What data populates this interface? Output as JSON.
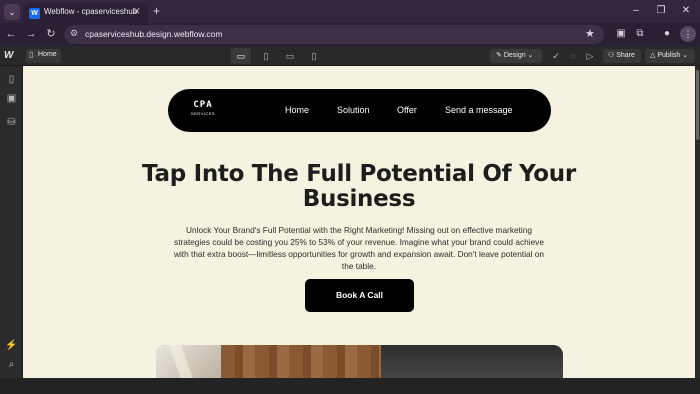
{
  "browser": {
    "tab_menu_icon": "chevron-down-icon",
    "tab_favicon_letter": "W",
    "tab_title": "Webflow - cpaserviceshub",
    "tab_close": "✕",
    "new_tab": "+",
    "url": "cpaserviceshub.design.webflow.com",
    "window_controls": [
      "–",
      "❐",
      "✕"
    ]
  },
  "webflow": {
    "logo": "W",
    "page_name": "Home",
    "design_label": "Design",
    "share_label": "Share",
    "publish_label": "Publish"
  },
  "site": {
    "logo_main": "CPA",
    "logo_sub": "SERVICES",
    "nav": [
      "Home",
      "Solution",
      "Offer",
      "Send a message"
    ],
    "hero_title": "Tap Into The Full Potential Of Your Business",
    "hero_body": "Unlock Your Brand's Full Potential with the Right Marketing! Missing out on effective marketing strategies could be costing you 25% to 53% of your revenue. Imagine what your brand could achieve with that extra boost—limitless opportunities for growth and expansion await. Don't leave potential on the table.",
    "cta_label": "Book A Call"
  },
  "colors": {
    "canvas_bg": "#f5f3df",
    "accent": "#000000",
    "webflow_blue": "#146ef5"
  }
}
